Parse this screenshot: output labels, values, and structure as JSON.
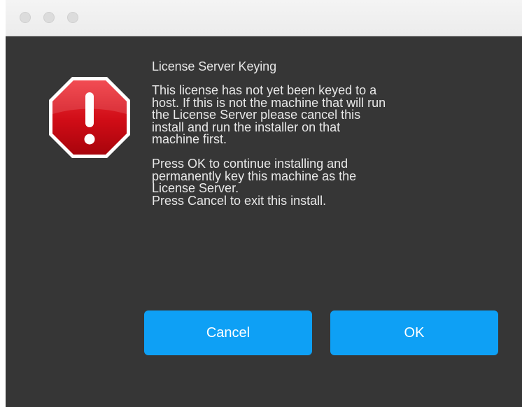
{
  "window": {
    "controls": [
      "close",
      "minimize",
      "zoom"
    ]
  },
  "dialog": {
    "icon": "stop-alert-icon",
    "heading": "License Server Keying",
    "message": "This license has not yet been keyed to a\nhost. If this is not the machine that will run\nthe License Server please cancel this\ninstall and run the installer on that\nmachine first.\n\nPress OK to continue installing and\npermanently key this machine as the\nLicense Server.\nPress Cancel to exit this install.",
    "buttons": {
      "cancel_label": "Cancel",
      "ok_label": "OK"
    },
    "colors": {
      "background": "#363636",
      "button": "#0ea0f5",
      "alert_red": "#d0101a"
    }
  }
}
